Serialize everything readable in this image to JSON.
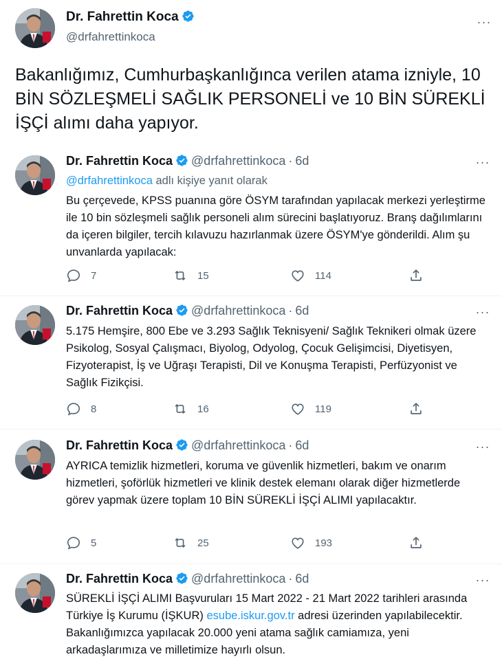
{
  "main_tweet": {
    "name": "Dr. Fahrettin Koca",
    "handle": "@drfahrettinkoca",
    "text": "Bakanlığımız, Cumhurbaşkanlığınca verilen atama izniyle, 10 BİN SÖZLEŞMELİ SAĞLIK PERSONELİ ve 10 BİN SÜREKLİ İŞÇİ alımı daha yapıyor."
  },
  "replies": [
    {
      "name": "Dr. Fahrettin Koca",
      "handle": "@drfahrettinkoca",
      "dot": "·",
      "time": "6d",
      "reply_to_mention": "@drfahrettinkoca",
      "reply_to_suffix": " adlı kişiye yanıt olarak",
      "text": "Bu çerçevede, KPSS puanına göre ÖSYM tarafından yapılacak merkezi yerleştirme ile 10 bin sözleşmeli sağlık personeli alım sürecini başlatıyoruz. Branş dağılımlarını da içeren bilgiler, tercih kılavuzu hazırlanmak üzere ÖSYM'ye gönderildi. Alım şu unvanlarda yapılacak:",
      "replies_count": "7",
      "retweets_count": "15",
      "likes_count": "114"
    },
    {
      "name": "Dr. Fahrettin Koca",
      "handle": "@drfahrettinkoca",
      "dot": "·",
      "time": "6d",
      "text": "5.175 Hemşire, 800 Ebe ve 3.293 Sağlık Teknisyeni/ Sağlık Teknikeri olmak üzere Psikolog, Sosyal Çalışmacı, Biyolog, Odyolog, Çocuk Gelişimcisi, Diyetisyen, Fizyoterapist, İş ve Uğraşı Terapisti, Dil ve Konuşma Terapisti, Perfüzyonist ve Sağlık Fizikçisi.",
      "replies_count": "8",
      "retweets_count": "16",
      "likes_count": "119"
    },
    {
      "name": "Dr. Fahrettin Koca",
      "handle": "@drfahrettinkoca",
      "dot": "·",
      "time": "6d",
      "text": "AYRICA temizlik hizmetleri, koruma ve güvenlik hizmetleri, bakım ve onarım hizmetleri, şoförlük hizmetleri ve klinik destek elemanı olarak diğer hizmetlerde görev yapmak üzere toplam 10 BİN SÜREKLİ İŞÇİ ALIMI yapılacaktır.",
      "replies_count": "5",
      "retweets_count": "25",
      "likes_count": "193"
    },
    {
      "name": "Dr. Fahrettin Koca",
      "handle": "@drfahrettinkoca",
      "dot": "·",
      "time": "6d",
      "text_before_link": "SÜREKLİ İŞÇİ ALIMI Başvuruları 15 Mart 2022 - 21 Mart 2022 tarihleri arasında Türkiye İş Kurumu (İŞKUR) ",
      "link": "esube.iskur.gov.tr",
      "text_after_link": " adresi üzerinden yapılabilecektir. Bakanlığımızca yapılacak 20.000 yeni atama sağlık camiamıza, yeni arkadaşlarımıza ve milletimize hayırlı olsun."
    }
  ],
  "icons": {
    "verified": "verified-badge-icon",
    "more": "more-options-icon",
    "reply": "reply-bubble-icon",
    "retweet": "retweet-icon",
    "like": "heart-icon",
    "share": "share-icon"
  },
  "colors": {
    "accent": "#1d9bf0",
    "secondary_text": "#536471",
    "text": "#0f1419"
  }
}
